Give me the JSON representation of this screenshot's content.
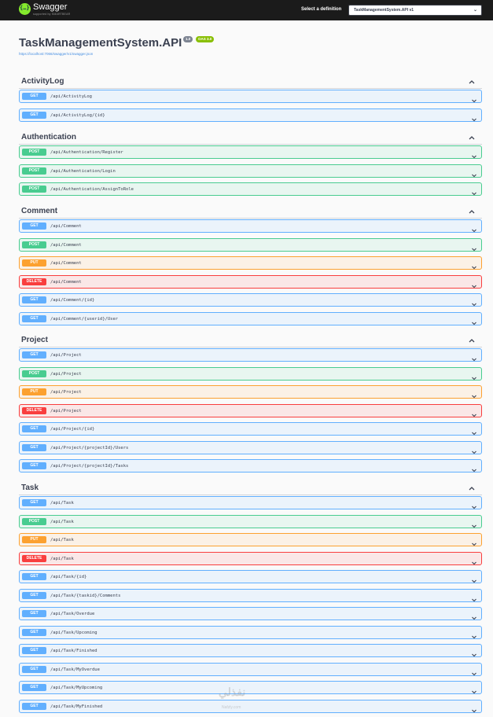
{
  "topbar": {
    "brand": "Swagger",
    "brand_sub": "supported by SMARTBEAR",
    "definition_label": "Select a definition",
    "definition_value": "TaskManagementSystem.API v1"
  },
  "info": {
    "title": "TaskManagementSystem.API",
    "version_badge": "1.0",
    "oas_badge": "OAS 3.0",
    "spec_url": "https://localhost:7066/swagger/v1/swagger.json"
  },
  "colors": {
    "get": "#61affe",
    "post": "#49cc90",
    "put": "#fca130",
    "delete": "#f93e3e"
  },
  "sections": [
    {
      "name": "ActivityLog",
      "ops": [
        {
          "method": "GET",
          "path": "/api/ActivityLog"
        },
        {
          "method": "GET",
          "path": "/api/ActivityLog/{id}"
        }
      ]
    },
    {
      "name": "Authentication",
      "ops": [
        {
          "method": "POST",
          "path": "/api/Authentication/Register"
        },
        {
          "method": "POST",
          "path": "/api/Authentication/Login"
        },
        {
          "method": "POST",
          "path": "/api/Authentication/AssignToRole"
        }
      ]
    },
    {
      "name": "Comment",
      "ops": [
        {
          "method": "GET",
          "path": "/api/Comment"
        },
        {
          "method": "POST",
          "path": "/api/Comment"
        },
        {
          "method": "PUT",
          "path": "/api/Comment"
        },
        {
          "method": "DELETE",
          "path": "/api/Comment"
        },
        {
          "method": "GET",
          "path": "/api/Comment/{id}"
        },
        {
          "method": "GET",
          "path": "/api/Comment/{userid}/User"
        }
      ]
    },
    {
      "name": "Project",
      "ops": [
        {
          "method": "GET",
          "path": "/api/Project"
        },
        {
          "method": "POST",
          "path": "/api/Project"
        },
        {
          "method": "PUT",
          "path": "/api/Project"
        },
        {
          "method": "DELETE",
          "path": "/api/Project"
        },
        {
          "method": "GET",
          "path": "/api/Project/{id}"
        },
        {
          "method": "GET",
          "path": "/api/Project/{projectId}/Users"
        },
        {
          "method": "GET",
          "path": "/api/Project/{projectId}/Tasks"
        }
      ]
    },
    {
      "name": "Task",
      "ops": [
        {
          "method": "GET",
          "path": "/api/Task"
        },
        {
          "method": "POST",
          "path": "/api/Task"
        },
        {
          "method": "PUT",
          "path": "/api/Task"
        },
        {
          "method": "DELETE",
          "path": "/api/Task"
        },
        {
          "method": "GET",
          "path": "/api/Task/{id}"
        },
        {
          "method": "GET",
          "path": "/api/Task/{taskid}/Comments"
        },
        {
          "method": "GET",
          "path": "/api/Task/Overdue"
        },
        {
          "method": "GET",
          "path": "/api/Task/Upcoming"
        },
        {
          "method": "GET",
          "path": "/api/Task/Finished"
        },
        {
          "method": "GET",
          "path": "/api/Task/MyOverdue"
        },
        {
          "method": "GET",
          "path": "/api/Task/MyUpcoming"
        },
        {
          "method": "GET",
          "path": "/api/Task/MyFinished"
        }
      ]
    }
  ],
  "watermark": {
    "text": "نفذلي",
    "sub": "Nafzly.com"
  }
}
